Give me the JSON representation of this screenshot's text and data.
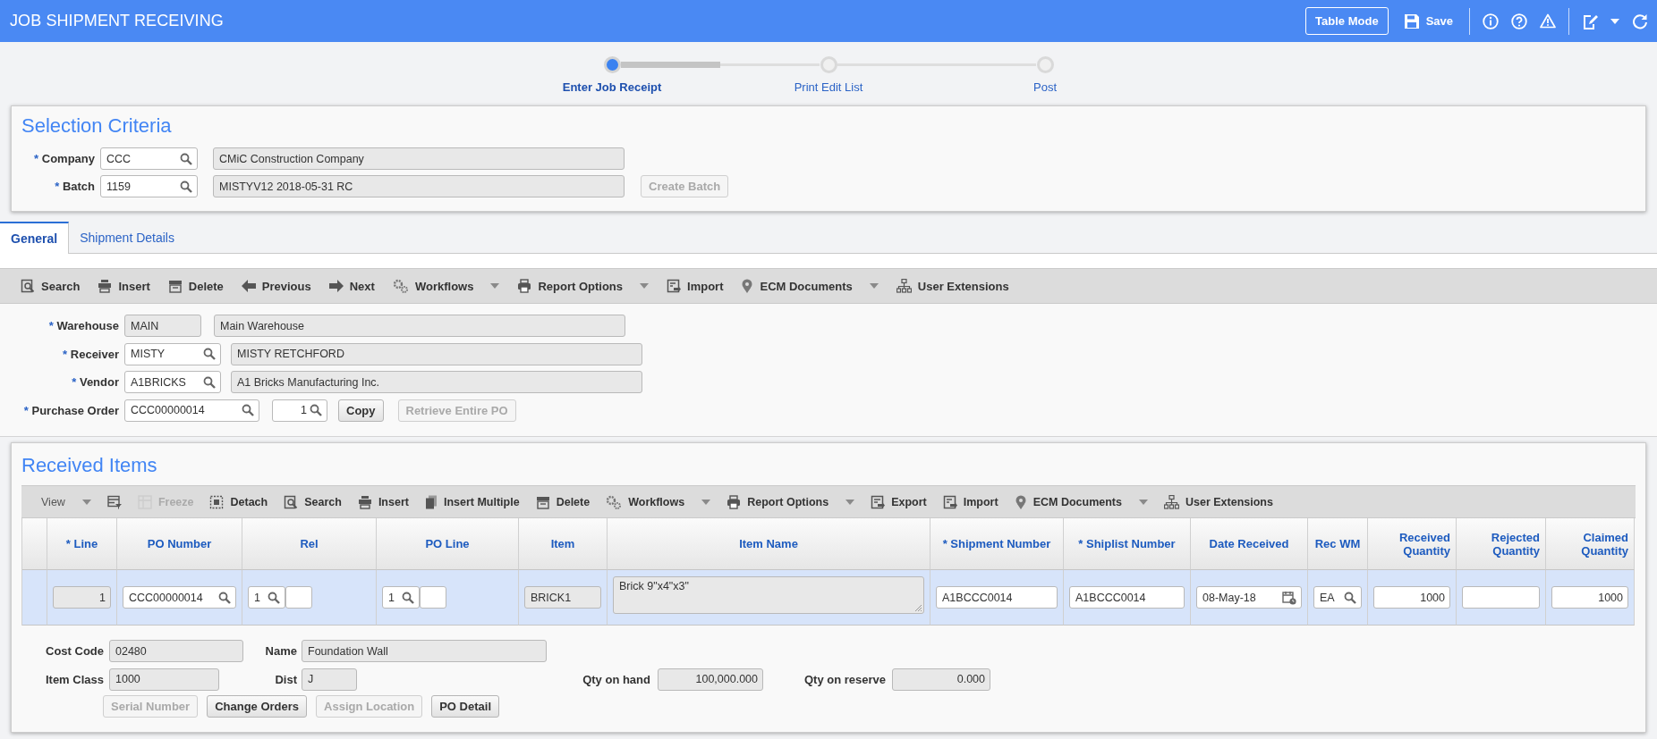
{
  "header": {
    "title": "JOB SHIPMENT RECEIVING",
    "buttons": [
      {
        "kind": "outlined",
        "label": "Table Mode"
      },
      {
        "kind": "save",
        "label": "Save"
      }
    ]
  },
  "progress_segments": [
    {
      "level": 0.5
    }
  ],
  "steps": [
    {
      "label": "Enter Job Receipt",
      "selected": true
    },
    {
      "label": "Print Edit List",
      "selected": false
    },
    {
      "label": "Post",
      "selected": false
    }
  ],
  "selection_criteria": {
    "title": "Selection Criteria",
    "fields": [
      {
        "required_mark": "*",
        "label": "Company",
        "value": "CCC",
        "description": "CMiC Construction Company"
      },
      {
        "required_mark": "*",
        "label": "Batch",
        "value": "1159",
        "description": "MISTYV12 2018-05-31 RC",
        "button": {
          "label": "Create Batch",
          "disabled": true
        }
      }
    ]
  },
  "tabs": [
    {
      "label": "General",
      "selected": true
    },
    {
      "label": "Shipment Details",
      "selected": false
    }
  ],
  "general_toolbar": [
    {
      "kind": "search",
      "label": "Search",
      "dropdown": false,
      "disabled": false
    },
    {
      "kind": "insert",
      "label": "Insert",
      "dropdown": false,
      "disabled": false
    },
    {
      "kind": "delete",
      "label": "Delete",
      "dropdown": false,
      "disabled": false
    },
    {
      "kind": "previous",
      "label": "Previous",
      "dropdown": false,
      "disabled": false
    },
    {
      "kind": "next",
      "label": "Next",
      "dropdown": false,
      "disabled": false
    },
    {
      "kind": "workflows",
      "label": "Workflows",
      "dropdown": true,
      "disabled": false
    },
    {
      "kind": "report",
      "label": "Report Options",
      "dropdown": true,
      "disabled": false
    },
    {
      "kind": "import",
      "label": "Import",
      "dropdown": false,
      "disabled": false
    },
    {
      "kind": "ecm",
      "label": "ECM Documents",
      "dropdown": true,
      "disabled": false
    },
    {
      "kind": "extensions",
      "label": "User Extensions",
      "dropdown": false,
      "disabled": false
    }
  ],
  "general_form": {
    "fields": [
      {
        "required_mark": "*",
        "label": "Warehouse",
        "value": "MAIN",
        "readonly": true,
        "lookup": false,
        "description": "Main Warehouse"
      },
      {
        "required_mark": "*",
        "label": "Receiver",
        "value": "MISTY",
        "readonly": false,
        "lookup": true,
        "description": "MISTY RETCHFORD"
      },
      {
        "required_mark": "*",
        "label": "Vendor",
        "value": "A1BRICKS",
        "readonly": false,
        "lookup": true,
        "description": "A1 Bricks Manufacturing Inc."
      },
      {
        "required_mark": "*",
        "label": "Purchase Order",
        "value": "CCC00000014",
        "readonly": false,
        "lookup": true,
        "release": {
          "value": "1"
        },
        "buttons": [
          {
            "label": "Copy",
            "disabled": false
          },
          {
            "label": "Retrieve Entire PO",
            "disabled": true
          }
        ]
      }
    ]
  },
  "received_items": {
    "title": "Received Items",
    "toolbar": [
      {
        "kind": "view",
        "label": "View",
        "dropdown": true,
        "disabled": false
      },
      {
        "kind": "columns",
        "dropdown": false,
        "disabled": false
      },
      {
        "kind": "freeze",
        "label": "Freeze",
        "dropdown": false,
        "disabled": true
      },
      {
        "kind": "detach",
        "label": "Detach",
        "dropdown": false,
        "disabled": false
      },
      {
        "kind": "search",
        "label": "Search",
        "dropdown": false,
        "disabled": false
      },
      {
        "kind": "insert",
        "label": "Insert",
        "dropdown": false,
        "disabled": false
      },
      {
        "kind": "insert_multiple",
        "label": "Insert Multiple",
        "dropdown": false,
        "disabled": false
      },
      {
        "kind": "delete",
        "label": "Delete",
        "dropdown": false,
        "disabled": false
      },
      {
        "kind": "workflows",
        "label": "Workflows",
        "dropdown": true,
        "disabled": false
      },
      {
        "kind": "report",
        "label": "Report Options",
        "dropdown": true,
        "disabled": false
      },
      {
        "kind": "export",
        "label": "Export",
        "dropdown": false,
        "disabled": false
      },
      {
        "kind": "import",
        "label": "Import",
        "dropdown": false,
        "disabled": false
      },
      {
        "kind": "ecm",
        "label": "ECM Documents",
        "dropdown": true,
        "disabled": false
      },
      {
        "kind": "extensions",
        "label": "User Extensions",
        "dropdown": false,
        "disabled": false
      }
    ],
    "columns": [
      {
        "label": "* Line",
        "numeric": false
      },
      {
        "label": "PO Number",
        "numeric": false
      },
      {
        "label": "Rel",
        "numeric": false
      },
      {
        "label": "PO Line",
        "numeric": false
      },
      {
        "label": "Item",
        "numeric": false
      },
      {
        "label": "Item Name",
        "numeric": false
      },
      {
        "label": "* Shipment Number",
        "numeric": false
      },
      {
        "label": "* Shiplist Number",
        "numeric": false
      },
      {
        "label": "Date Received",
        "numeric": false
      },
      {
        "label": "Rec WM",
        "numeric": false
      },
      {
        "label": "Received Quantity",
        "numeric": true
      },
      {
        "label": "Rejected Quantity",
        "numeric": true
      },
      {
        "label": "Claimed Quantity",
        "numeric": true
      }
    ],
    "rows": [
      {
        "selected": true,
        "cells": [
          {
            "kind": "readonly",
            "value": "1",
            "numeric": true
          },
          {
            "kind": "lookup",
            "value": "CCC00000014",
            "numeric": false
          },
          {
            "kind": "lookup_pair",
            "value": "1",
            "numeric": false
          },
          {
            "kind": "lookup_pair",
            "value": "1",
            "numeric": false
          },
          {
            "kind": "readonly",
            "value": "BRICK1",
            "numeric": false
          },
          {
            "kind": "textarea",
            "value": "Brick 9\"x4\"x3\"",
            "numeric": false
          },
          {
            "kind": "input",
            "value": "A1BCCC0014",
            "numeric": false
          },
          {
            "kind": "input",
            "value": "A1BCCC0014",
            "numeric": false
          },
          {
            "kind": "date",
            "value": "08-May-18",
            "numeric": false
          },
          {
            "kind": "lookup",
            "value": "EA",
            "numeric": false
          },
          {
            "kind": "input",
            "value": "1000",
            "numeric": true
          },
          {
            "kind": "input",
            "numeric": true
          },
          {
            "kind": "input",
            "value": "1000",
            "numeric": true
          }
        ]
      }
    ],
    "details": {
      "fields": [
        {
          "label": "Cost Code",
          "value": "02480",
          "numeric": false
        },
        {
          "label": "Name",
          "value": "Foundation Wall",
          "numeric": false
        },
        {
          "label": "Item Class",
          "value": "1000",
          "numeric": false
        },
        {
          "label": "Dist",
          "value": "J",
          "numeric": false
        },
        {
          "label": "Qty on hand",
          "value": "100,000.000",
          "numeric": true
        },
        {
          "label": "Qty on reserve",
          "value": "0.000",
          "numeric": true
        }
      ],
      "buttons": [
        {
          "label": "Serial Number",
          "disabled": true
        },
        {
          "label": "Change Orders",
          "disabled": false
        },
        {
          "label": "Assign Location",
          "disabled": true
        },
        {
          "label": "PO Detail",
          "disabled": false
        }
      ]
    }
  }
}
